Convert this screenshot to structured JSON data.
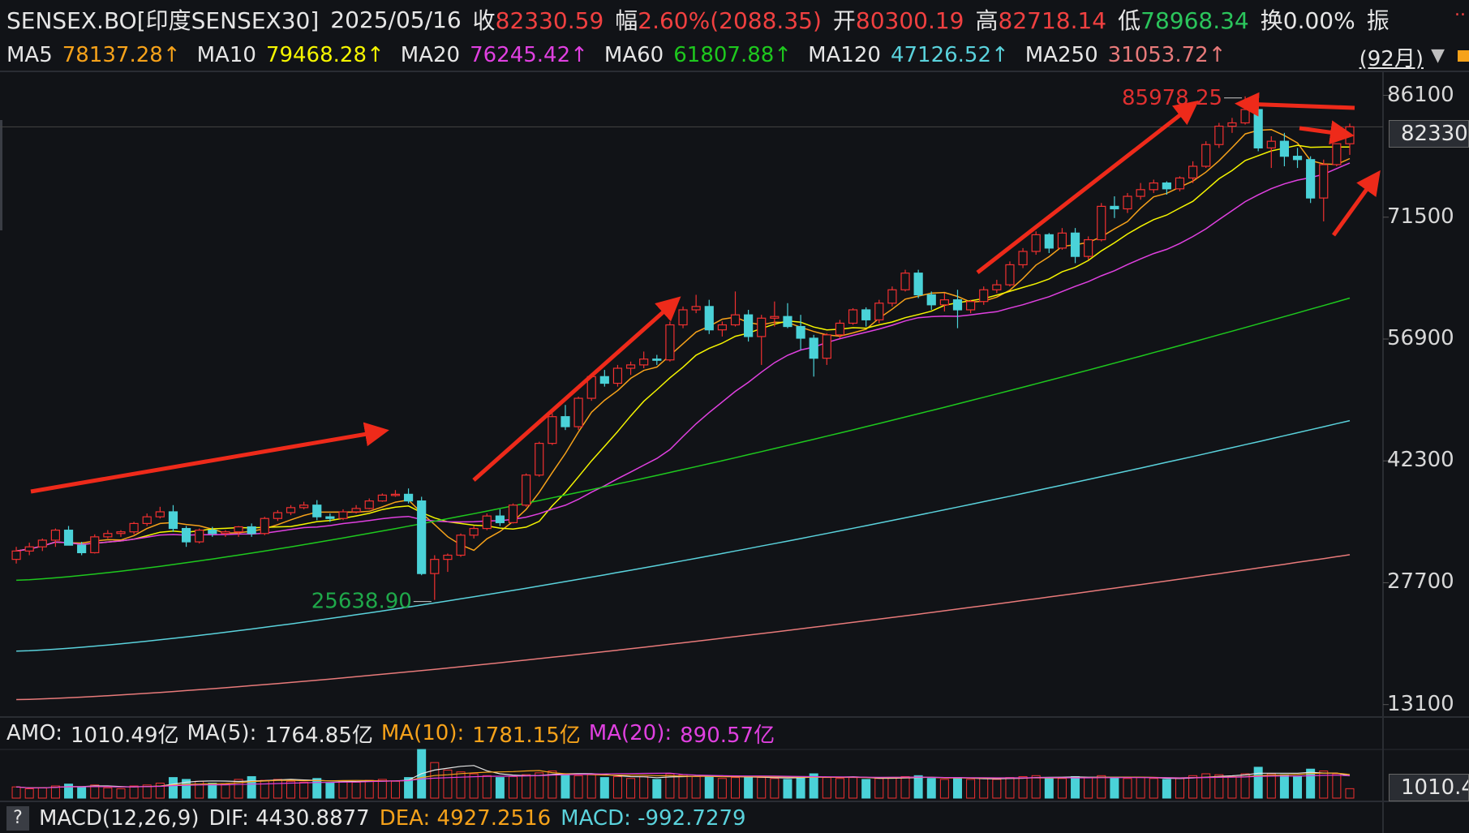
{
  "header": {
    "symbol": "SENSEX.BO[印度SENSEX30]",
    "date": "2025/05/16",
    "close_label": "收",
    "close_value": "82330.59",
    "change_label": "幅",
    "change_value": "2.60%(2088.35)",
    "open_label": "开",
    "open_value": "80300.19",
    "high_label": "高",
    "high_value": "82718.14",
    "low_label": "低",
    "low_value": "78968.34",
    "turnover_label": "换",
    "turnover_value": "0.00%",
    "amplitude_label": "振"
  },
  "ma_bar": {
    "items": [
      {
        "label": "MA5",
        "value": "78137.28↑",
        "color": "#f6a21a"
      },
      {
        "label": "MA10",
        "value": "79468.28↑",
        "color": "#f5f500"
      },
      {
        "label": "MA20",
        "value": "76245.42↑",
        "color": "#e040e0"
      },
      {
        "label": "MA60",
        "value": "61807.88↑",
        "color": "#1ec81e"
      },
      {
        "label": "MA120",
        "value": "47126.52↑",
        "color": "#5ad2dc"
      },
      {
        "label": "MA250",
        "value": "31053.72↑",
        "color": "#e87a7a"
      }
    ],
    "period": "(92月)",
    "dropdown_icon": "triangle-down-icon",
    "overflow": ".."
  },
  "price_panel": {
    "current_price": "82330.",
    "high_marker": "85978.25",
    "low_marker": "25638.90",
    "high_marker_color": "#e03030",
    "low_marker_color": "#1fa84a"
  },
  "amo_bar": {
    "amo_label": "AMO:",
    "amo_value": "1010.49亿",
    "ma5_label": "MA(5):",
    "ma5_value": "1764.85亿",
    "ma10_label": "MA(10):",
    "ma10_value": "1781.15亿",
    "ma20_label": "MA(20):",
    "ma20_value": "890.57亿",
    "current_volume": "1010.4"
  },
  "macd_bar": {
    "help": "?",
    "label": "MACD(12,26,9)",
    "dif_label": "DIF:",
    "dif_value": "4430.8877",
    "dea_label": "DEA:",
    "dea_value": "4927.2516",
    "macd_label": "MACD:",
    "macd_value": "-992.7279"
  },
  "colors": {
    "up": "#f03030",
    "down": "#4ad2d8",
    "background": "#111317",
    "grid": "#2a2d33",
    "annotation_arrow": "#ee2a1a"
  },
  "chart_data": {
    "type": "candlestick",
    "y_ticks": [
      86100,
      71500,
      56900,
      42300,
      27700,
      13100
    ],
    "ylim": [
      12000,
      88000
    ],
    "grid": false,
    "volume_unit": "亿",
    "candles": [
      {
        "o": 30500,
        "h": 32000,
        "l": 30000,
        "c": 31500,
        "v": 120
      },
      {
        "o": 31500,
        "h": 32500,
        "l": 31000,
        "c": 32000,
        "v": 100
      },
      {
        "o": 32000,
        "h": 33000,
        "l": 31500,
        "c": 32800,
        "v": 110
      },
      {
        "o": 32800,
        "h": 34200,
        "l": 32000,
        "c": 34000,
        "v": 130
      },
      {
        "o": 34000,
        "h": 34500,
        "l": 32500,
        "c": 32200,
        "v": 150
      },
      {
        "o": 32200,
        "h": 32600,
        "l": 31000,
        "c": 31300,
        "v": 120
      },
      {
        "o": 31300,
        "h": 33500,
        "l": 31200,
        "c": 33200,
        "v": 140
      },
      {
        "o": 33200,
        "h": 34000,
        "l": 33000,
        "c": 33600,
        "v": 110
      },
      {
        "o": 33600,
        "h": 34000,
        "l": 33200,
        "c": 33800,
        "v": 100
      },
      {
        "o": 33800,
        "h": 35000,
        "l": 33500,
        "c": 34800,
        "v": 130
      },
      {
        "o": 34800,
        "h": 36000,
        "l": 34500,
        "c": 35600,
        "v": 140
      },
      {
        "o": 35600,
        "h": 36800,
        "l": 35400,
        "c": 36200,
        "v": 160
      },
      {
        "o": 36200,
        "h": 37000,
        "l": 33800,
        "c": 34200,
        "v": 220
      },
      {
        "o": 34200,
        "h": 34500,
        "l": 32000,
        "c": 32600,
        "v": 200
      },
      {
        "o": 32600,
        "h": 34200,
        "l": 32400,
        "c": 34000,
        "v": 180
      },
      {
        "o": 34000,
        "h": 34400,
        "l": 33200,
        "c": 33600,
        "v": 160
      },
      {
        "o": 33600,
        "h": 34000,
        "l": 33200,
        "c": 33800,
        "v": 150
      },
      {
        "o": 33800,
        "h": 34500,
        "l": 33200,
        "c": 34400,
        "v": 200
      },
      {
        "o": 34400,
        "h": 34800,
        "l": 33200,
        "c": 33600,
        "v": 230
      },
      {
        "o": 33600,
        "h": 35600,
        "l": 33400,
        "c": 35400,
        "v": 190
      },
      {
        "o": 35400,
        "h": 36400,
        "l": 35100,
        "c": 36100,
        "v": 200
      },
      {
        "o": 36100,
        "h": 37000,
        "l": 35800,
        "c": 36700,
        "v": 180
      },
      {
        "o": 36700,
        "h": 37400,
        "l": 36500,
        "c": 37000,
        "v": 170
      },
      {
        "o": 37000,
        "h": 37600,
        "l": 35200,
        "c": 35600,
        "v": 210
      },
      {
        "o": 35600,
        "h": 36000,
        "l": 35000,
        "c": 35400,
        "v": 160
      },
      {
        "o": 35400,
        "h": 36500,
        "l": 35200,
        "c": 36200,
        "v": 180
      },
      {
        "o": 36200,
        "h": 37000,
        "l": 36000,
        "c": 36600,
        "v": 170
      },
      {
        "o": 36600,
        "h": 37800,
        "l": 36500,
        "c": 37500,
        "v": 190
      },
      {
        "o": 37500,
        "h": 38400,
        "l": 37400,
        "c": 38200,
        "v": 200
      },
      {
        "o": 38200,
        "h": 38800,
        "l": 38000,
        "c": 38300,
        "v": 180
      },
      {
        "o": 38300,
        "h": 39000,
        "l": 37200,
        "c": 37500,
        "v": 220
      },
      {
        "o": 37500,
        "h": 38000,
        "l": 28600,
        "c": 28800,
        "v": 520
      },
      {
        "o": 28800,
        "h": 31000,
        "l": 25638.9,
        "c": 30500,
        "v": 380
      },
      {
        "o": 30500,
        "h": 31200,
        "l": 29000,
        "c": 31000,
        "v": 300
      },
      {
        "o": 31000,
        "h": 33600,
        "l": 30800,
        "c": 33400,
        "v": 280
      },
      {
        "o": 33400,
        "h": 34500,
        "l": 33000,
        "c": 34200,
        "v": 260
      },
      {
        "o": 34200,
        "h": 36000,
        "l": 34000,
        "c": 35700,
        "v": 240
      },
      {
        "o": 35700,
        "h": 36500,
        "l": 34500,
        "c": 34900,
        "v": 220
      },
      {
        "o": 34900,
        "h": 37200,
        "l": 34800,
        "c": 37000,
        "v": 230
      },
      {
        "o": 37000,
        "h": 40800,
        "l": 36800,
        "c": 40600,
        "v": 250
      },
      {
        "o": 40600,
        "h": 44600,
        "l": 40400,
        "c": 44400,
        "v": 270
      },
      {
        "o": 44400,
        "h": 48000,
        "l": 44200,
        "c": 47600,
        "v": 290
      },
      {
        "o": 47600,
        "h": 49000,
        "l": 46000,
        "c": 46400,
        "v": 260
      },
      {
        "o": 46400,
        "h": 50000,
        "l": 46000,
        "c": 49800,
        "v": 240
      },
      {
        "o": 49800,
        "h": 52800,
        "l": 49500,
        "c": 52400,
        "v": 250
      },
      {
        "o": 52400,
        "h": 53200,
        "l": 51200,
        "c": 51600,
        "v": 220
      },
      {
        "o": 51600,
        "h": 53800,
        "l": 51200,
        "c": 53400,
        "v": 230
      },
      {
        "o": 53400,
        "h": 54200,
        "l": 52600,
        "c": 53800,
        "v": 210
      },
      {
        "o": 53800,
        "h": 55400,
        "l": 53400,
        "c": 54500,
        "v": 230
      },
      {
        "o": 54500,
        "h": 55000,
        "l": 53800,
        "c": 54400,
        "v": 200
      },
      {
        "o": 54400,
        "h": 59000,
        "l": 54200,
        "c": 58600,
        "v": 260
      },
      {
        "o": 58600,
        "h": 60800,
        "l": 58200,
        "c": 60400,
        "v": 250
      },
      {
        "o": 60400,
        "h": 62200,
        "l": 60000,
        "c": 60800,
        "v": 230
      },
      {
        "o": 60800,
        "h": 61600,
        "l": 57500,
        "c": 58000,
        "v": 240
      },
      {
        "o": 58000,
        "h": 59000,
        "l": 57200,
        "c": 58600,
        "v": 210
      },
      {
        "o": 58600,
        "h": 62600,
        "l": 58400,
        "c": 59800,
        "v": 220
      },
      {
        "o": 59800,
        "h": 60400,
        "l": 56600,
        "c": 57200,
        "v": 230
      },
      {
        "o": 57200,
        "h": 59800,
        "l": 53800,
        "c": 59400,
        "v": 220
      },
      {
        "o": 59400,
        "h": 61400,
        "l": 58400,
        "c": 59600,
        "v": 210
      },
      {
        "o": 59600,
        "h": 61200,
        "l": 58200,
        "c": 58400,
        "v": 200
      },
      {
        "o": 58400,
        "h": 59800,
        "l": 55600,
        "c": 57000,
        "v": 230
      },
      {
        "o": 57000,
        "h": 57400,
        "l": 52400,
        "c": 54600,
        "v": 260
      },
      {
        "o": 54600,
        "h": 57600,
        "l": 53800,
        "c": 57400,
        "v": 220
      },
      {
        "o": 57400,
        "h": 59200,
        "l": 57000,
        "c": 58800,
        "v": 210
      },
      {
        "o": 58800,
        "h": 60600,
        "l": 58600,
        "c": 60400,
        "v": 220
      },
      {
        "o": 60400,
        "h": 60700,
        "l": 58400,
        "c": 59200,
        "v": 200
      },
      {
        "o": 59200,
        "h": 61600,
        "l": 58800,
        "c": 61200,
        "v": 210
      },
      {
        "o": 61200,
        "h": 63200,
        "l": 60800,
        "c": 62800,
        "v": 220
      },
      {
        "o": 62800,
        "h": 65200,
        "l": 62600,
        "c": 64800,
        "v": 230
      },
      {
        "o": 64800,
        "h": 65200,
        "l": 61800,
        "c": 62200,
        "v": 240
      },
      {
        "o": 62200,
        "h": 62600,
        "l": 60400,
        "c": 61000,
        "v": 210
      },
      {
        "o": 61000,
        "h": 62400,
        "l": 60200,
        "c": 61600,
        "v": 200
      },
      {
        "o": 61600,
        "h": 62800,
        "l": 58200,
        "c": 60400,
        "v": 220
      },
      {
        "o": 60400,
        "h": 61600,
        "l": 60000,
        "c": 61400,
        "v": 200
      },
      {
        "o": 61400,
        "h": 63200,
        "l": 61000,
        "c": 62800,
        "v": 210
      },
      {
        "o": 62800,
        "h": 64000,
        "l": 62400,
        "c": 63400,
        "v": 200
      },
      {
        "o": 63400,
        "h": 66200,
        "l": 63200,
        "c": 65800,
        "v": 220
      },
      {
        "o": 65800,
        "h": 67800,
        "l": 65400,
        "c": 67400,
        "v": 230
      },
      {
        "o": 67400,
        "h": 69800,
        "l": 67000,
        "c": 69400,
        "v": 240
      },
      {
        "o": 69400,
        "h": 69600,
        "l": 67200,
        "c": 67800,
        "v": 220
      },
      {
        "o": 67800,
        "h": 70200,
        "l": 67600,
        "c": 69600,
        "v": 210
      },
      {
        "o": 69600,
        "h": 70200,
        "l": 66000,
        "c": 66800,
        "v": 230
      },
      {
        "o": 66800,
        "h": 69200,
        "l": 66400,
        "c": 68800,
        "v": 220
      },
      {
        "o": 68800,
        "h": 73200,
        "l": 68600,
        "c": 72800,
        "v": 240
      },
      {
        "o": 72800,
        "h": 74000,
        "l": 71400,
        "c": 72500,
        "v": 220
      },
      {
        "o": 72500,
        "h": 74400,
        "l": 72000,
        "c": 74000,
        "v": 210
      },
      {
        "o": 74000,
        "h": 75600,
        "l": 73600,
        "c": 74800,
        "v": 220
      },
      {
        "o": 74800,
        "h": 76000,
        "l": 74400,
        "c": 75600,
        "v": 210
      },
      {
        "o": 75600,
        "h": 75800,
        "l": 74200,
        "c": 74900,
        "v": 200
      },
      {
        "o": 74900,
        "h": 76400,
        "l": 74600,
        "c": 76200,
        "v": 210
      },
      {
        "o": 76200,
        "h": 78200,
        "l": 75600,
        "c": 77600,
        "v": 240
      },
      {
        "o": 77600,
        "h": 80600,
        "l": 77400,
        "c": 80200,
        "v": 260
      },
      {
        "o": 80200,
        "h": 82800,
        "l": 79800,
        "c": 82400,
        "v": 250
      },
      {
        "o": 82400,
        "h": 83400,
        "l": 81600,
        "c": 82800,
        "v": 230
      },
      {
        "o": 82800,
        "h": 85978.25,
        "l": 82600,
        "c": 84400,
        "v": 260
      },
      {
        "o": 84400,
        "h": 85600,
        "l": 79400,
        "c": 79800,
        "v": 330
      },
      {
        "o": 79800,
        "h": 81200,
        "l": 77400,
        "c": 80600,
        "v": 260
      },
      {
        "o": 80600,
        "h": 81600,
        "l": 77600,
        "c": 78800,
        "v": 250
      },
      {
        "o": 78800,
        "h": 79800,
        "l": 77400,
        "c": 78400,
        "v": 230
      },
      {
        "o": 78400,
        "h": 78800,
        "l": 73200,
        "c": 73800,
        "v": 310
      },
      {
        "o": 73800,
        "h": 78400,
        "l": 71000,
        "c": 77800,
        "v": 290
      },
      {
        "o": 77800,
        "h": 80200,
        "l": 77600,
        "c": 80300,
        "v": 260
      },
      {
        "o": 80300.19,
        "h": 82718.14,
        "l": 78968.34,
        "c": 82330.59,
        "v": 101
      }
    ],
    "ma_series": [
      {
        "name": "MA5",
        "color": "#f6a21a"
      },
      {
        "name": "MA10",
        "color": "#f5f500"
      },
      {
        "name": "MA20",
        "color": "#e040e0"
      },
      {
        "name": "MA60",
        "color": "#1ec81e",
        "from": 28000,
        "to": 61807.88
      },
      {
        "name": "MA120",
        "color": "#5ad2dc",
        "from": 19500,
        "to": 47126.52
      },
      {
        "name": "MA250",
        "color": "#e87a7a",
        "from": 13700,
        "to": 31053.72
      }
    ],
    "annotations": [
      {
        "label": "high",
        "value": 85978.25
      },
      {
        "label": "low",
        "value": 25638.9
      }
    ]
  }
}
